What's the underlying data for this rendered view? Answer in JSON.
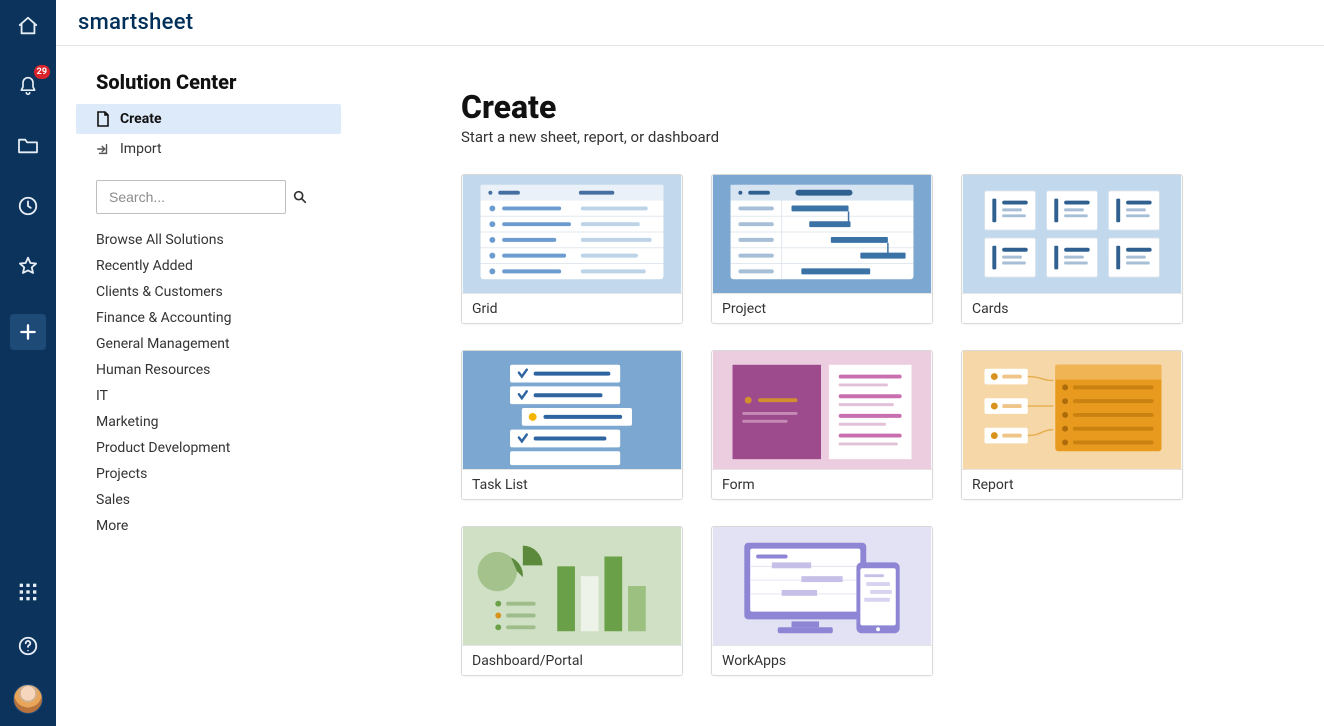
{
  "app_name": "smartsheet",
  "nav": {
    "notification_count": "29"
  },
  "sidebar": {
    "title": "Solution Center",
    "actions": {
      "create": "Create",
      "import": "Import"
    },
    "search_placeholder": "Search...",
    "links": [
      "Browse All Solutions",
      "Recently Added",
      "Clients & Customers",
      "Finance & Accounting",
      "General Management",
      "Human Resources",
      "IT",
      "Marketing",
      "Product Development",
      "Projects",
      "Sales",
      "More"
    ]
  },
  "main": {
    "title": "Create",
    "subtitle": "Start a new sheet, report, or dashboard",
    "cards": [
      "Grid",
      "Project",
      "Cards",
      "Task List",
      "Form",
      "Report",
      "Dashboard/Portal",
      "WorkApps"
    ]
  }
}
